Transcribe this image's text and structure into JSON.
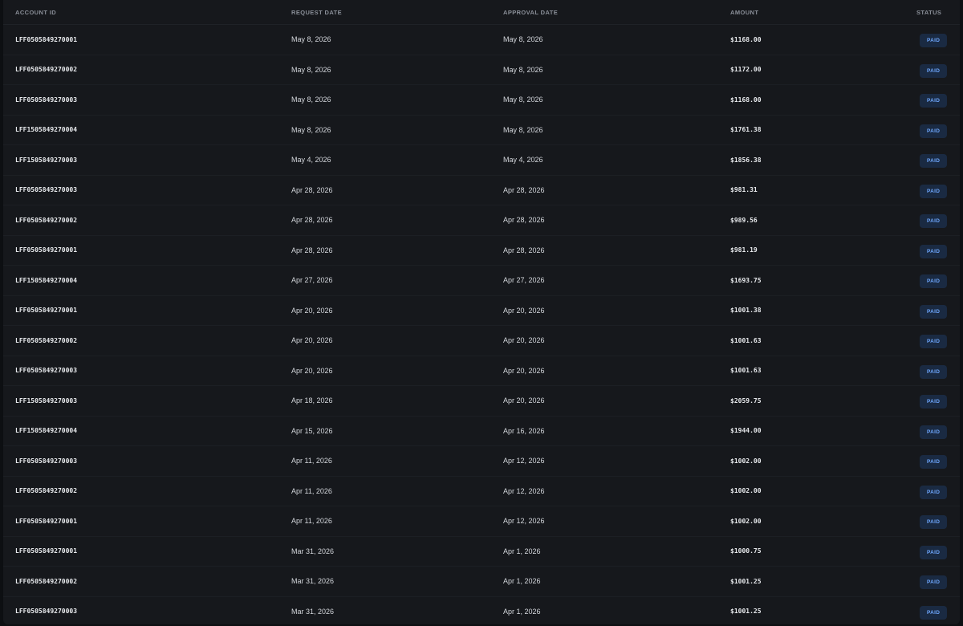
{
  "header": {
    "account_id": "ACCOUNT ID",
    "request_date": "REQUEST DATE",
    "approval_date": "APPROVAL DATE",
    "amount": "AMOUNT",
    "status": "STATUS"
  },
  "rows": [
    {
      "account_id": "LFF0505849270001",
      "request_date": "May 8, 2026",
      "approval_date": "May 8, 2026",
      "amount": "$1168.00",
      "status": "PAID"
    },
    {
      "account_id": "LFF0505849270002",
      "request_date": "May 8, 2026",
      "approval_date": "May 8, 2026",
      "amount": "$1172.00",
      "status": "PAID"
    },
    {
      "account_id": "LFF0505849270003",
      "request_date": "May 8, 2026",
      "approval_date": "May 8, 2026",
      "amount": "$1168.00",
      "status": "PAID"
    },
    {
      "account_id": "LFF1505849270004",
      "request_date": "May 8, 2026",
      "approval_date": "May 8, 2026",
      "amount": "$1761.38",
      "status": "PAID"
    },
    {
      "account_id": "LFF1505849270003",
      "request_date": "May 4, 2026",
      "approval_date": "May 4, 2026",
      "amount": "$1856.38",
      "status": "PAID"
    },
    {
      "account_id": "LFF0505849270003",
      "request_date": "Apr 28, 2026",
      "approval_date": "Apr 28, 2026",
      "amount": "$981.31",
      "status": "PAID"
    },
    {
      "account_id": "LFF0505849270002",
      "request_date": "Apr 28, 2026",
      "approval_date": "Apr 28, 2026",
      "amount": "$989.56",
      "status": "PAID"
    },
    {
      "account_id": "LFF0505849270001",
      "request_date": "Apr 28, 2026",
      "approval_date": "Apr 28, 2026",
      "amount": "$981.19",
      "status": "PAID"
    },
    {
      "account_id": "LFF1505849270004",
      "request_date": "Apr 27, 2026",
      "approval_date": "Apr 27, 2026",
      "amount": "$1693.75",
      "status": "PAID"
    },
    {
      "account_id": "LFF0505849270001",
      "request_date": "Apr 20, 2026",
      "approval_date": "Apr 20, 2026",
      "amount": "$1001.38",
      "status": "PAID"
    },
    {
      "account_id": "LFF0505849270002",
      "request_date": "Apr 20, 2026",
      "approval_date": "Apr 20, 2026",
      "amount": "$1001.63",
      "status": "PAID"
    },
    {
      "account_id": "LFF0505849270003",
      "request_date": "Apr 20, 2026",
      "approval_date": "Apr 20, 2026",
      "amount": "$1001.63",
      "status": "PAID"
    },
    {
      "account_id": "LFF1505849270003",
      "request_date": "Apr 18, 2026",
      "approval_date": "Apr 20, 2026",
      "amount": "$2059.75",
      "status": "PAID"
    },
    {
      "account_id": "LFF1505849270004",
      "request_date": "Apr 15, 2026",
      "approval_date": "Apr 16, 2026",
      "amount": "$1944.00",
      "status": "PAID"
    },
    {
      "account_id": "LFF0505849270003",
      "request_date": "Apr 11, 2026",
      "approval_date": "Apr 12, 2026",
      "amount": "$1002.00",
      "status": "PAID"
    },
    {
      "account_id": "LFF0505849270002",
      "request_date": "Apr 11, 2026",
      "approval_date": "Apr 12, 2026",
      "amount": "$1002.00",
      "status": "PAID"
    },
    {
      "account_id": "LFF0505849270001",
      "request_date": "Apr 11, 2026",
      "approval_date": "Apr 12, 2026",
      "amount": "$1002.00",
      "status": "PAID"
    },
    {
      "account_id": "LFF0505849270001",
      "request_date": "Mar 31, 2026",
      "approval_date": "Apr 1, 2026",
      "amount": "$1000.75",
      "status": "PAID"
    },
    {
      "account_id": "LFF0505849270002",
      "request_date": "Mar 31, 2026",
      "approval_date": "Apr 1, 2026",
      "amount": "$1001.25",
      "status": "PAID"
    },
    {
      "account_id": "LFF0505849270003",
      "request_date": "Mar 31, 2026",
      "approval_date": "Apr 1, 2026",
      "amount": "$1001.25",
      "status": "PAID"
    }
  ],
  "colors": {
    "background": "#0d0f12",
    "panel": "#16181c",
    "badge_bg": "#1a2a42",
    "badge_text": "#6ea8ff"
  }
}
